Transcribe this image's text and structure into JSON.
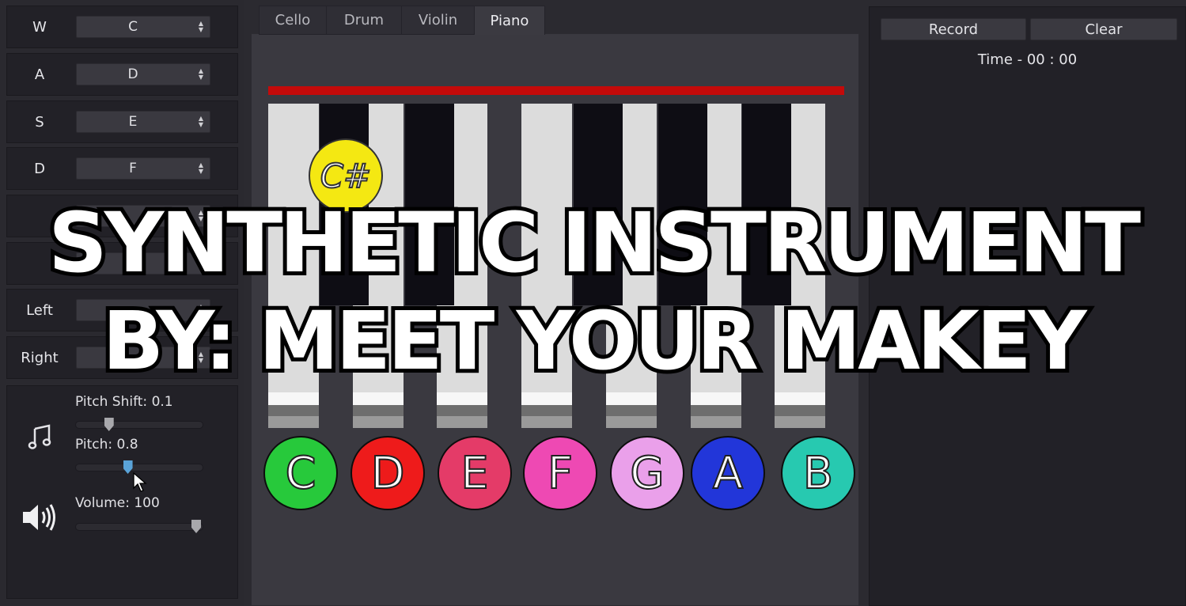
{
  "key_map": [
    {
      "key": "W",
      "note": "C"
    },
    {
      "key": "A",
      "note": "D"
    },
    {
      "key": "S",
      "note": "E"
    },
    {
      "key": "D",
      "note": "F"
    },
    {
      "key": "",
      "note": ""
    },
    {
      "key": "",
      "note": ""
    },
    {
      "key": "Left",
      "note": ""
    },
    {
      "key": "Right",
      "note": ""
    }
  ],
  "controls": {
    "pitch_shift_label": "Pitch Shift: 0.1",
    "pitch_shift_value": 0.1,
    "pitch_label": "Pitch: 0.8",
    "pitch_value": 0.8,
    "volume_label": "Volume: 100",
    "volume_value": 100,
    "music_icon": "music-note-icon",
    "speaker_icon": "speaker-icon"
  },
  "tabs": [
    "Cello",
    "Drum",
    "Violin",
    "Piano"
  ],
  "active_tab": "Piano",
  "piano": {
    "white_keys": [
      "C",
      "D",
      "E",
      "F",
      "G",
      "A",
      "B"
    ],
    "note_colors": [
      "#27c93b",
      "#ee1b1b",
      "#e43b68",
      "#ee49b3",
      "#eaa0ea",
      "#2236d9",
      "#27c9b0"
    ],
    "sharp_label": "C#",
    "sharp_color": "#f4e812",
    "accent_bar_color": "#c40a0a"
  },
  "recorder": {
    "record_label": "Record",
    "clear_label": "Clear",
    "time_label": "Time - 00 : 00"
  },
  "overlay": {
    "line1": "SYNTHETIC INSTRUMENT",
    "line2": "BY: MEET YOUR MAKEY"
  }
}
